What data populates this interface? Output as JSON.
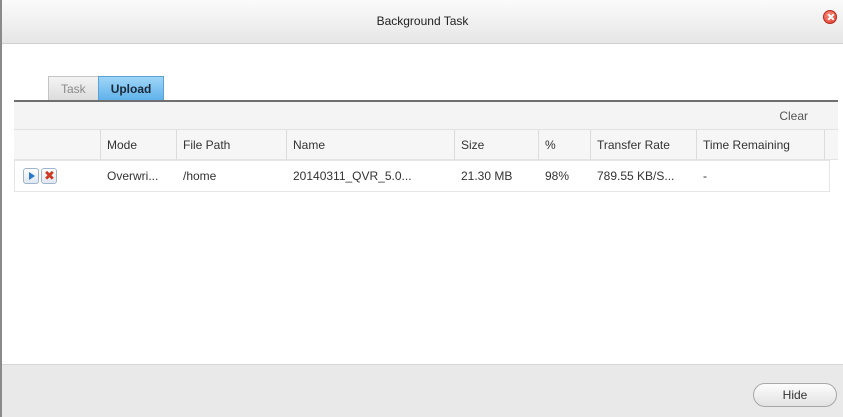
{
  "window": {
    "title": "Background Task"
  },
  "tabs": [
    {
      "label": "Task",
      "active": false
    },
    {
      "label": "Upload",
      "active": true
    }
  ],
  "toolbar": {
    "clear_label": "Clear"
  },
  "table": {
    "columns": [
      "Mode",
      "File Path",
      "Name",
      "Size",
      "%",
      "Transfer Rate",
      "Time Remaining"
    ],
    "rows": [
      {
        "actions": [
          "play-icon",
          "cancel-icon"
        ],
        "mode": "Overwri...",
        "file_path": "/home",
        "name": "20140311_QVR_5.0...",
        "size": "21.30 MB",
        "percent": "98%",
        "transfer_rate": "789.55 KB/S...",
        "time_remaining": "-"
      }
    ]
  },
  "footer": {
    "hide_label": "Hide"
  },
  "colors": {
    "accent_tab": "#5fb2ea",
    "close": "#d93a2b"
  }
}
